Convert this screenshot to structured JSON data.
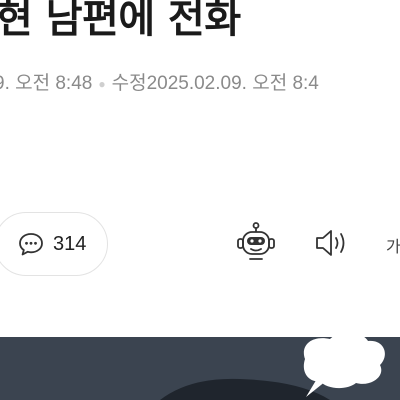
{
  "article": {
    "headline": "현 남편에 전화",
    "published": "9. 오전 8:48",
    "modified_label": "수정",
    "modified": "2025.02.09. 오전 8:4"
  },
  "toolbar": {
    "comment_count": "314",
    "font_button_label": "가",
    "icons": [
      "comment-icon",
      "ai-bot-icon",
      "speaker-icon",
      "font-size-icon"
    ]
  },
  "colors": {
    "headline": "#1a1a1a",
    "meta": "#8a8a8a",
    "image_background": "#3b4450"
  }
}
